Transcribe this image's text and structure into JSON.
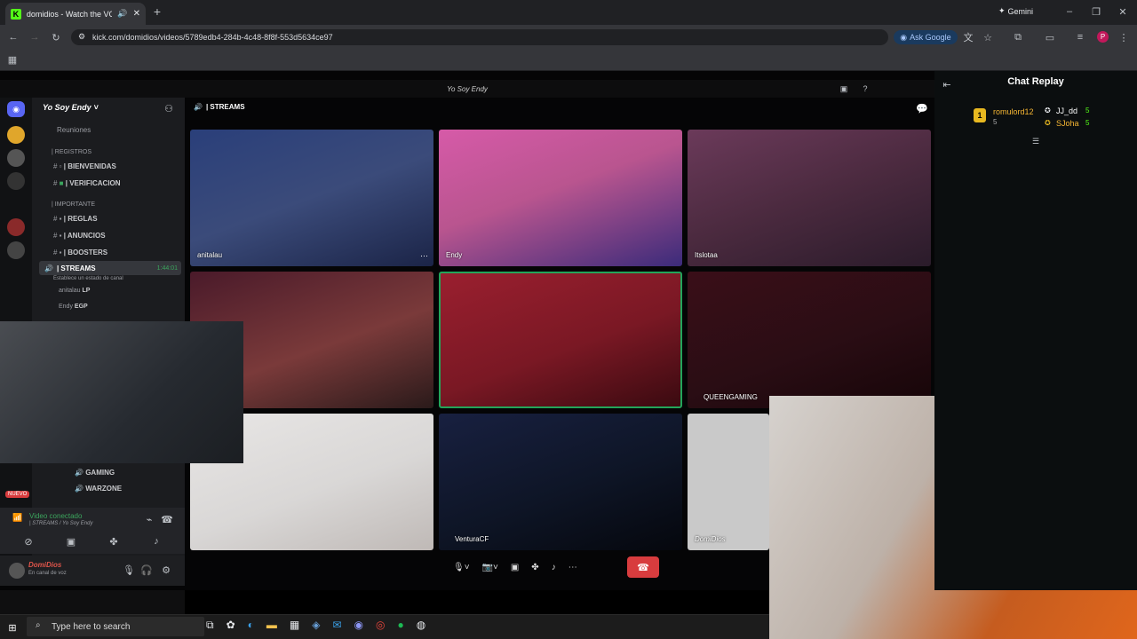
{
  "browser": {
    "tab_title": "domidios - Watch the VOD",
    "url": "kick.com/domidios/videos/5789edb4-284b-4c48-8f8f-553d5634ce97",
    "ask_google": "Ask Google",
    "gemini": "Gemini"
  },
  "discord": {
    "window_title": "Yo Soy Endy",
    "server_name": "Yo Soy Endy",
    "channel_header": "| STREAMS",
    "channels": [
      {
        "label": "Reuniones"
      },
      {
        "label": "| REGISTROS"
      },
      {
        "label": "| BIENVENIDAS"
      },
      {
        "label": "| VERIFICACION"
      },
      {
        "label": "| IMPORTANTE"
      },
      {
        "label": "| REGLAS"
      },
      {
        "label": "| ANUNCIOS"
      },
      {
        "label": "| BOOSTERS"
      },
      {
        "label": "| STREAMS"
      },
      {
        "label": "GAMING"
      },
      {
        "label": "WARZONE"
      }
    ],
    "stream_time": "1:44:01",
    "stream_status": "Establece un estado de canal",
    "voice_users": [
      {
        "name": "anitalau",
        "tag": "LP"
      },
      {
        "name": "Endy",
        "tag": "EGP"
      }
    ],
    "video_status": "Video conectado",
    "video_channel": "| STREAMS / Yo Soy Endy",
    "user": {
      "name": "DomiDios",
      "status": "En canal de voz"
    },
    "nuevo_badge": "NUEVO",
    "tiles": [
      {
        "name": "anitalau",
        "color": "#3b4b7a"
      },
      {
        "name": "Endy",
        "color": "#b9558f"
      },
      {
        "name": "Itslotaa",
        "color": "#4b2a3f"
      },
      {
        "name": "",
        "color": "#4a1a2a"
      },
      {
        "name": "",
        "color": "#7a1824"
      },
      {
        "name": "QUEENGAMING",
        "color": "#2a0d14"
      },
      {
        "name": "",
        "color": "#d9d7d6"
      },
      {
        "name": "VenturaCF",
        "color": "#0e1526"
      },
      {
        "name": "DomiDios",
        "color": "#c9c9c9"
      }
    ]
  },
  "chat_replay": {
    "title": "Chat Replay",
    "entries": [
      {
        "rank": "1",
        "user": "romulord12",
        "points": "5"
      },
      {
        "user": "JJ_dd",
        "points": "5"
      },
      {
        "user": "SJoha",
        "points": "5"
      }
    ]
  },
  "taskbar": {
    "search_placeholder": "Type here to search"
  },
  "colors": {
    "kick_green": "#53fc18",
    "discord_red": "#d83c3e",
    "active_tile_border": "#23a55a"
  }
}
